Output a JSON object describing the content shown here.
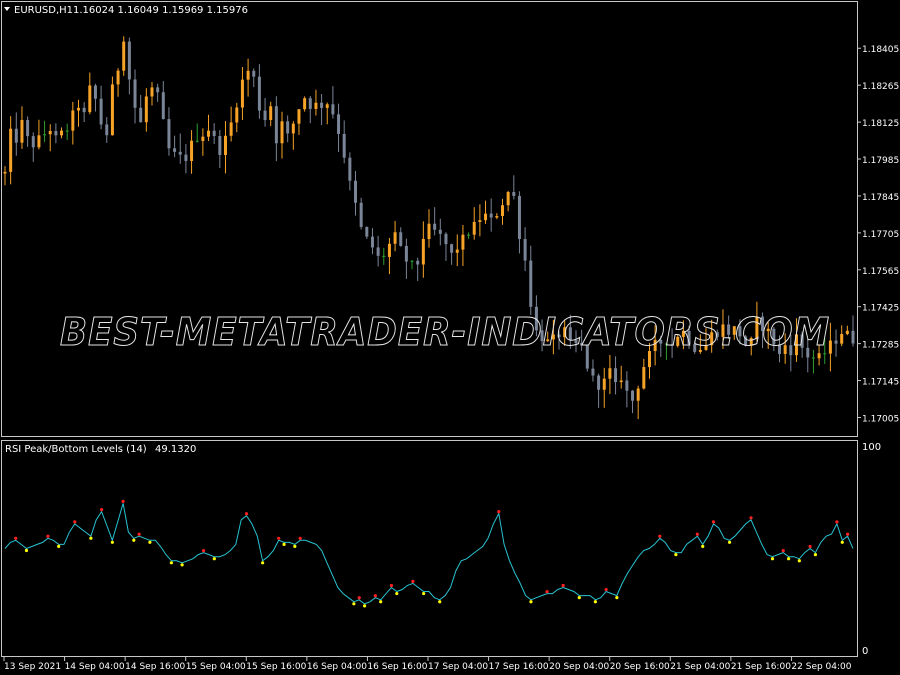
{
  "price_panel": {
    "symbol_label": "EURUSD,H1",
    "ohlc_label": "1.16024 1.16049 1.15969 1.15976",
    "menu_icon": "triangle-down-icon",
    "price_levels": [
      "1.18405",
      "1.18265",
      "1.18125",
      "1.17985",
      "1.17845",
      "1.17705",
      "1.17565",
      "1.17425",
      "1.17285",
      "1.17145",
      "1.17005"
    ]
  },
  "indicator_panel": {
    "title": "RSI Peak/Bottom Levels (14)",
    "value": "49.1320",
    "level_max": "100",
    "level_min": "0"
  },
  "time_axis": {
    "labels": [
      "13 Sep 2021",
      "14 Sep 04:00",
      "14 Sep 16:00",
      "15 Sep 04:00",
      "15 Sep 16:00",
      "16 Sep 04:00",
      "16 Sep 16:00",
      "17 Sep 04:00",
      "17 Sep 16:00",
      "20 Sep 04:00",
      "20 Sep 16:00",
      "21 Sep 04:00",
      "21 Sep 16:00",
      "22 Sep 04:00"
    ]
  },
  "watermark": {
    "text": "BEST-METATRADER-INDICATORS.COM"
  },
  "colors": {
    "background": "#000000",
    "bull_candle": "#f7a327",
    "bear_candle": "#7b8598",
    "doji_candle": "#2e9f2e",
    "rsi_line": "#28c3d2",
    "peak_marker": "#ff2020",
    "bottom_marker": "#ffff00",
    "axis_text": "#ffffff",
    "frame": "#c8c8c8"
  },
  "chart_data": [
    {
      "type": "candlestick",
      "symbol": "EURUSD",
      "timeframe": "H1",
      "ylim": [
        1.1695,
        1.1855
      ],
      "trend": [
        1.1793,
        1.1808,
        1.1806,
        1.1812,
        1.1806,
        1.1804,
        1.1806,
        1.1808,
        1.181,
        1.1806,
        1.1808,
        1.181,
        1.1815,
        1.1819,
        1.1815,
        1.1825,
        1.1821,
        1.1812,
        1.1808,
        1.1825,
        1.1833,
        1.1845,
        1.1829,
        1.1818,
        1.1812,
        1.1822,
        1.1825,
        1.1822,
        1.1812,
        1.1802,
        1.18,
        1.1799,
        1.1799,
        1.1804,
        1.1807,
        1.1808,
        1.181,
        1.1806,
        1.1802,
        1.1806,
        1.1812,
        1.182,
        1.1828,
        1.1832,
        1.1829,
        1.1818,
        1.1814,
        1.1819,
        1.1806,
        1.1812,
        1.1807,
        1.1812,
        1.1818,
        1.1822,
        1.1819,
        1.1819,
        1.1819,
        1.182,
        1.1816,
        1.1809,
        1.18,
        1.1789,
        1.1781,
        1.1772,
        1.1768,
        1.1765,
        1.1761,
        1.1762,
        1.1766,
        1.1769,
        1.1764,
        1.176,
        1.1758,
        1.1759,
        1.1769,
        1.1772,
        1.1771,
        1.1769,
        1.1766,
        1.1762,
        1.1765,
        1.1768,
        1.1771,
        1.1773,
        1.1776,
        1.1777,
        1.1775,
        1.1778,
        1.1782,
        1.1786,
        1.1784,
        1.177,
        1.176,
        1.1744,
        1.1733,
        1.1731,
        1.1729,
        1.173,
        1.1732,
        1.1733,
        1.1728,
        1.1728,
        1.1727,
        1.172,
        1.1715,
        1.1713,
        1.1714,
        1.1718,
        1.1712,
        1.1716,
        1.171,
        1.1707,
        1.1713,
        1.172,
        1.1724,
        1.1728,
        1.1729,
        1.173,
        1.1728,
        1.1732,
        1.1733,
        1.173,
        1.1727,
        1.1727,
        1.1728,
        1.1732,
        1.1733,
        1.1735,
        1.1733,
        1.1734,
        1.1732,
        1.1728,
        1.1729,
        1.1737,
        1.1735,
        1.1733,
        1.1729,
        1.1724,
        1.1728,
        1.1726,
        1.1731,
        1.1727,
        1.1724,
        1.1723,
        1.1723,
        1.1725,
        1.1728,
        1.173,
        1.1733,
        1.1732,
        1.173
      ]
    },
    {
      "type": "line",
      "name": "RSI Peak/Bottom Levels (14)",
      "ylim": [
        0,
        100
      ],
      "values": [
        50,
        53,
        54,
        52,
        50,
        51,
        52,
        53,
        55,
        54,
        52,
        52,
        58,
        62,
        60,
        58,
        56,
        64,
        68,
        61,
        54,
        63,
        72,
        58,
        55,
        56,
        55,
        54,
        54,
        51,
        47,
        44,
        44,
        43,
        44,
        45,
        47,
        48,
        47,
        46,
        46,
        47,
        49,
        52,
        64,
        66,
        62,
        56,
        44,
        46,
        49,
        54,
        53,
        53,
        52,
        54,
        54,
        53,
        52,
        49,
        43,
        37,
        31,
        28,
        26,
        24,
        25,
        23,
        24,
        26,
        25,
        28,
        31,
        29,
        30,
        32,
        33,
        31,
        29,
        29,
        26,
        25,
        27,
        31,
        39,
        44,
        45,
        47,
        49,
        51,
        55,
        62,
        67,
        52,
        44,
        38,
        33,
        27,
        25,
        26,
        27,
        28,
        28,
        30,
        31,
        30,
        29,
        27,
        27,
        27,
        25,
        26,
        29,
        28,
        27,
        33,
        38,
        42,
        46,
        49,
        50,
        52,
        55,
        53,
        49,
        48,
        48,
        52,
        54,
        56,
        52,
        56,
        62,
        60,
        55,
        54,
        56,
        59,
        62,
        64,
        58,
        52,
        47,
        46,
        47,
        48,
        46,
        46,
        45,
        48,
        50,
        48,
        53,
        56,
        57,
        62,
        54,
        56,
        50
      ]
    }
  ]
}
